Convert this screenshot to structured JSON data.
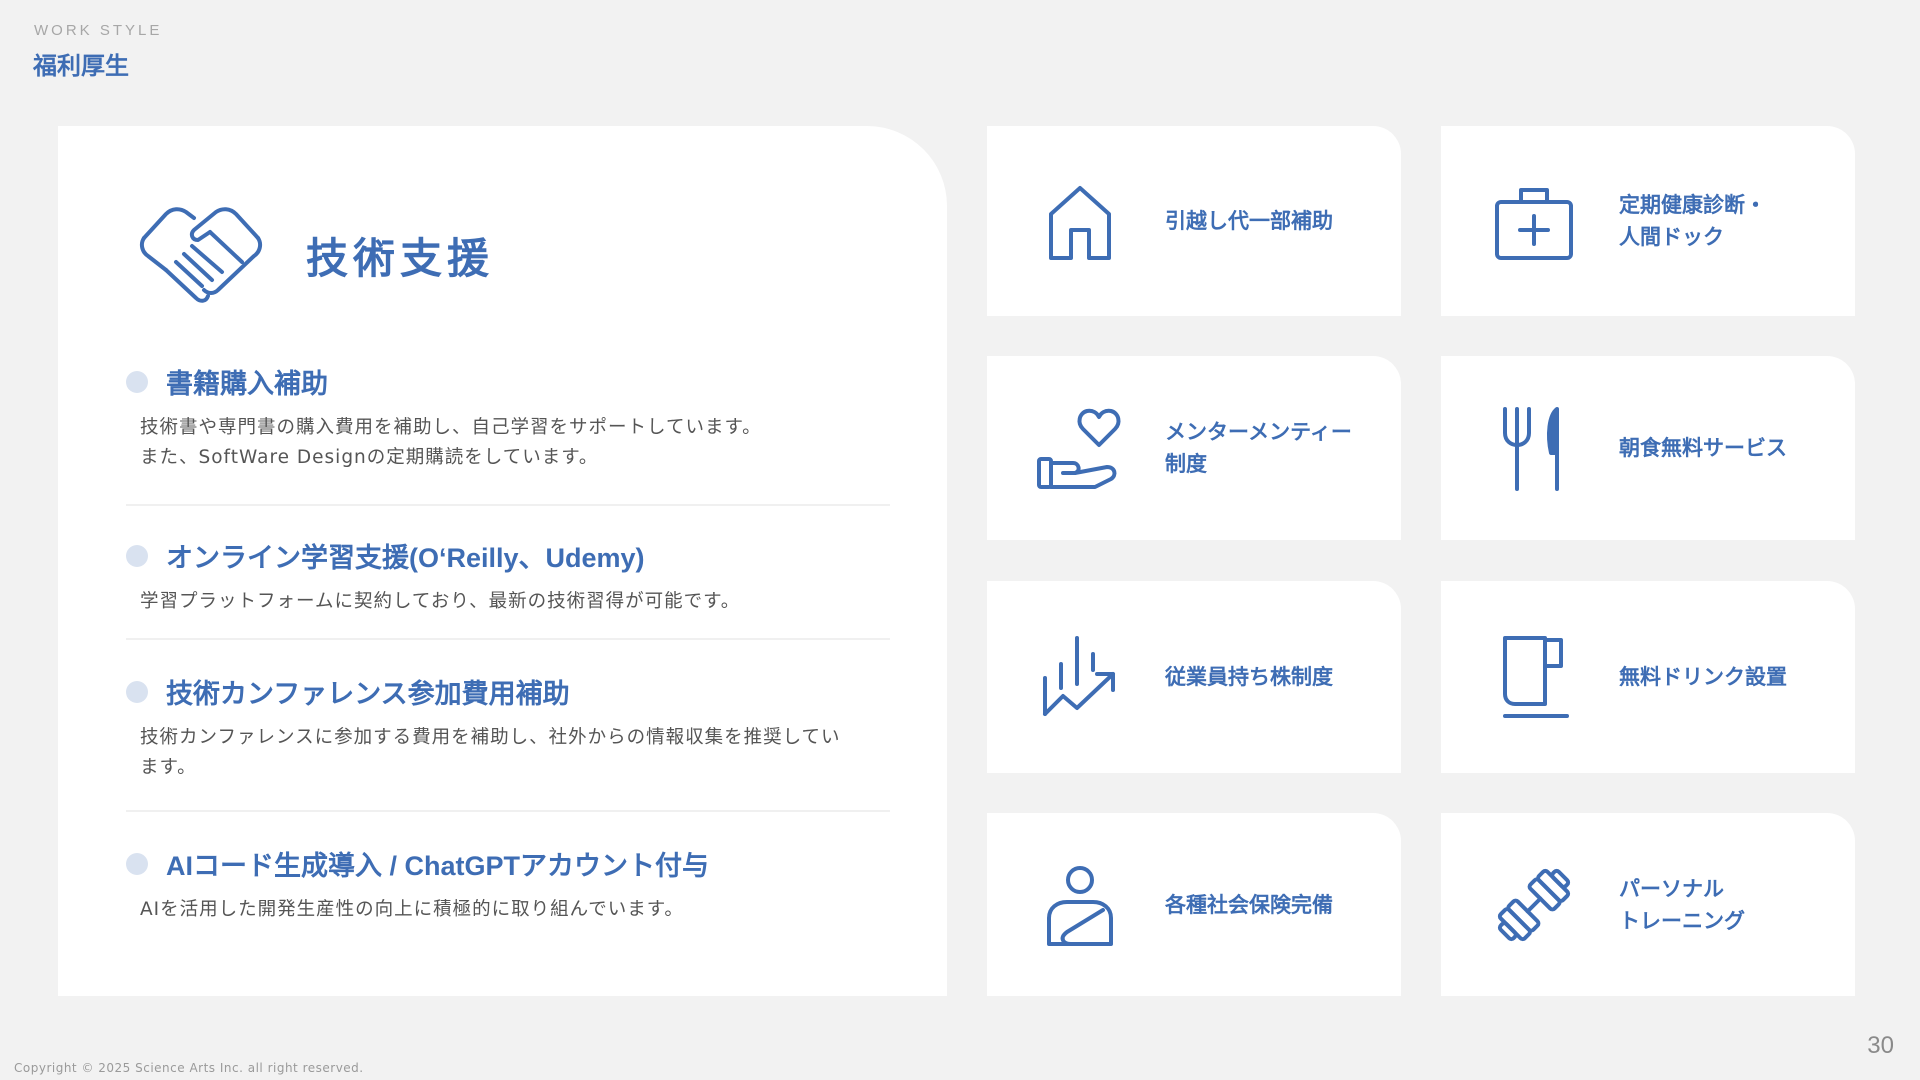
{
  "header": {
    "eyebrow": "WORK STYLE",
    "title": "福利厚生"
  },
  "tech_support": {
    "icon": "handshake-icon",
    "title": "技術支援",
    "items": [
      {
        "title": "書籍購入補助",
        "description": "技術書や専門書の購入費用を補助し、自己学習をサポートしています。\nまた、SoftWare Designの定期購読をしています。"
      },
      {
        "title": "オンライン学習支援(O‘Reilly、Udemy)",
        "description": "学習プラットフォームに契約しており、最新の技術習得が可能です。"
      },
      {
        "title": "技術カンファレンス参加費用補助",
        "description": "技術カンファレンスに参加する費用を補助し、社外からの情報収集を推奨してい\nます。"
      },
      {
        "title": "AIコード生成導入 / ChatGPTアカウント付与",
        "description": "AIを活用した開発生産性の向上に積極的に取り組んでいます。"
      }
    ]
  },
  "benefits": [
    {
      "icon": "house-icon",
      "label": "引越し代一部補助"
    },
    {
      "icon": "medical-kit-icon",
      "label": "定期健康診断・\n人間ドック"
    },
    {
      "icon": "heart-hand-icon",
      "label": "メンターメンティー\n制度"
    },
    {
      "icon": "fork-knife-icon",
      "label": "朝食無料サービス"
    },
    {
      "icon": "growth-chart-icon",
      "label": "従業員持ち株制度"
    },
    {
      "icon": "mug-icon",
      "label": "無料ドリンク設置"
    },
    {
      "icon": "person-insurance-icon",
      "label": "各種社会保険完備"
    },
    {
      "icon": "dumbbell-icon",
      "label": "パーソナル\nトレーニング"
    }
  ],
  "footer": {
    "page_number": "30",
    "copyright": "Copyright © 2025 Science Arts Inc. all right reserved."
  },
  "colors": {
    "accent": "#3e6db4",
    "background": "#f2f2f2",
    "card": "#ffffff",
    "bullet": "#d9e2f0"
  }
}
